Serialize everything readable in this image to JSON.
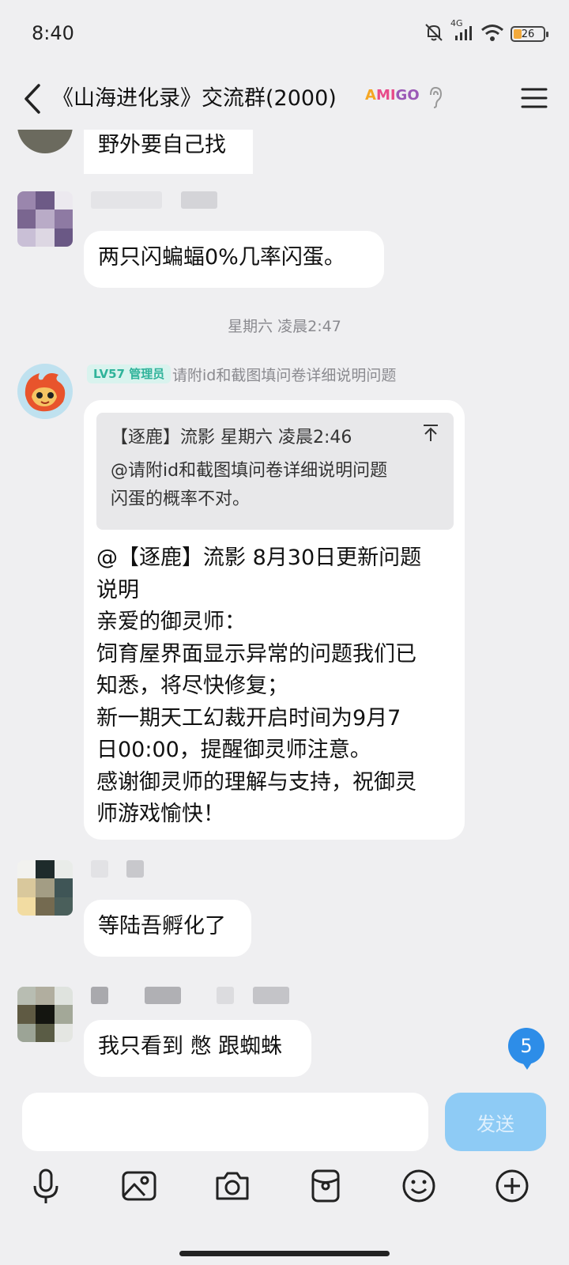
{
  "status": {
    "time": "8:40",
    "network": "4G",
    "battery": "26"
  },
  "header": {
    "title": "《山海进化录》交流群(2000)",
    "brand": [
      "A",
      "MI",
      "GO"
    ]
  },
  "messages": {
    "m1_text": "野外要自己找",
    "m2_text": "两只闪蝙蝠0%几率闪蛋。",
    "timestamp": "星期六 凌晨2:47",
    "m3": {
      "badge": "LV57 管理员",
      "sender": "请附id和截图填问卷详细说明问题",
      "quote_header": "【逐鹿】流影 星期六 凌晨2:46",
      "quote_line1": "@请附id和截图填问卷详细说明问题",
      "quote_line2": "闪蛋的概率不对。",
      "lines": [
        "@【逐鹿】流影 8月30日更新问题",
        "说明",
        "亲爱的御灵师：",
        "饲育屋界面显示异常的问题我们已",
        "知悉，将尽快修复；",
        "新一期天工幻裁开启时间为9月7",
        "日00:00，提醒御灵师注意。",
        "感谢御灵师的理解与支持，祝御灵",
        "师游戏愉快！"
      ]
    },
    "m4_text": "等陆吾孵化了",
    "m5_text": "我只看到 憋 跟蜘蛛"
  },
  "unread_count": "5",
  "input": {
    "send_label": "发送"
  },
  "colors": {
    "accent": "#2d8de8",
    "send_disabled": "#8ecbf5",
    "badge_bg": "#d9f3ee",
    "badge_fg": "#2fb39a"
  }
}
